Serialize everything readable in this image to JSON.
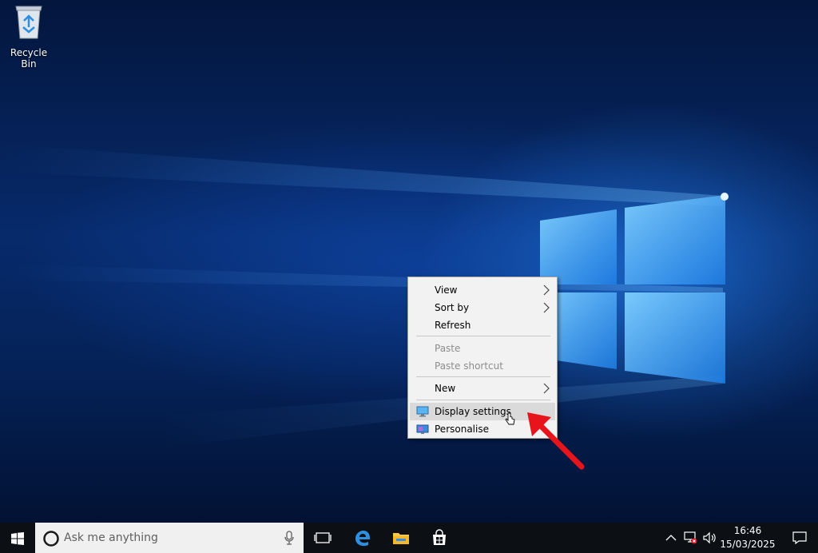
{
  "desktop": {
    "icons": [
      {
        "label": "Recycle Bin",
        "icon": "recycle-bin-icon"
      }
    ]
  },
  "context_menu": {
    "groups": [
      [
        {
          "label": "View",
          "submenu": true,
          "enabled": true
        },
        {
          "label": "Sort by",
          "submenu": true,
          "enabled": true
        },
        {
          "label": "Refresh",
          "submenu": false,
          "enabled": true
        }
      ],
      [
        {
          "label": "Paste",
          "submenu": false,
          "enabled": false
        },
        {
          "label": "Paste shortcut",
          "submenu": false,
          "enabled": false
        }
      ],
      [
        {
          "label": "New",
          "submenu": true,
          "enabled": true
        }
      ],
      [
        {
          "label": "Display settings",
          "submenu": false,
          "enabled": true,
          "highlighted": true,
          "icon": "display-icon"
        },
        {
          "label": "Personalise",
          "submenu": false,
          "enabled": true,
          "icon": "personalise-icon"
        }
      ]
    ]
  },
  "annotation": {
    "arrow_color": "#e8141c"
  },
  "taskbar": {
    "search_placeholder": "Ask me anything",
    "pinned": [
      "task-view-icon",
      "edge-icon",
      "file-explorer-icon",
      "store-icon"
    ],
    "tray": [
      "chevron-up-icon",
      "network-disconnected-icon",
      "volume-icon"
    ],
    "clock": {
      "time": "16:46",
      "date": "15/03/2025"
    }
  },
  "colors": {
    "accent": "#0078d7",
    "taskbar": "#0c0f14",
    "menu_bg": "#f2f2f2",
    "menu_hover": "#dadada"
  }
}
